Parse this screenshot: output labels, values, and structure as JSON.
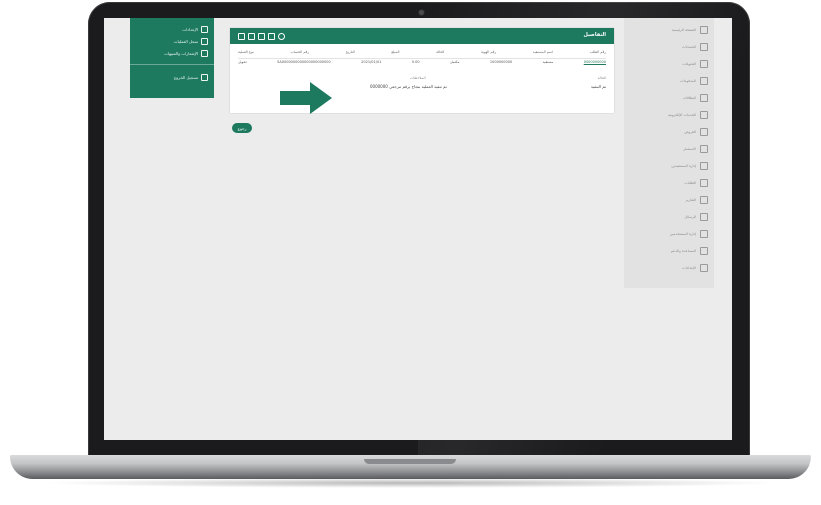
{
  "left_panel": {
    "items": [
      {
        "label": "الإعدادات",
        "icon": "settings-icon"
      },
      {
        "label": "سجل العمليات",
        "icon": "log-icon"
      },
      {
        "label": "الإشعارات والتنبيهات",
        "icon": "bell-icon"
      },
      {
        "label": "تسجيل الخروج",
        "icon": "logout-icon"
      }
    ]
  },
  "card": {
    "title": "التفاصيل",
    "header_icons": [
      "list-icon",
      "grid-icon",
      "document-icon",
      "print-icon",
      "info-icon"
    ],
    "columns": [
      "رقم الطلب",
      "اسم المستفيد",
      "رقم الهوية",
      "الحالة",
      "المبلغ",
      "التاريخ",
      "رقم الحساب",
      "نوع العملية"
    ],
    "row": [
      "0000000000",
      "مستفيد",
      "1000000000",
      "مكتمل",
      "0.00",
      "2021/01/01",
      "SA0000000000000000000000",
      "تحويل"
    ],
    "detail_label": "الحالة",
    "detail_value": "تم التنفيذ",
    "detail_label_2": "الملاحظات",
    "detail_value_2": "تم تنفيذ العملية بنجاح برقم مرجعي 0000000"
  },
  "back_button_label": "رجوع",
  "right_sidebar": {
    "items": [
      {
        "label": "الصفحة الرئيسية",
        "icon": "home-icon"
      },
      {
        "label": "الحسابات",
        "icon": "accounts-icon"
      },
      {
        "label": "التحويلات",
        "icon": "transfer-icon"
      },
      {
        "label": "المدفوعات",
        "icon": "payments-icon"
      },
      {
        "label": "البطاقات",
        "icon": "card-icon"
      },
      {
        "label": "الخدمات الإلكترونية",
        "icon": "services-icon"
      },
      {
        "label": "القروض",
        "icon": "loan-icon"
      },
      {
        "label": "الاستثمار",
        "icon": "chart-icon"
      },
      {
        "label": "إدارة المستفيدين",
        "icon": "users-icon"
      },
      {
        "label": "الطلبات",
        "icon": "request-icon"
      },
      {
        "label": "التقارير",
        "icon": "report-icon"
      },
      {
        "label": "الرسائل",
        "icon": "mail-icon"
      },
      {
        "label": "إدارة المستخدمين",
        "icon": "user-admin-icon"
      },
      {
        "label": "المساعدة والدعم",
        "icon": "help-icon"
      },
      {
        "label": "الإعدادات",
        "icon": "gear-icon"
      }
    ]
  },
  "colors": {
    "accent": "#1d7a5f",
    "sidebar_bg": "#e2e2e2",
    "screen_bg": "#ececec"
  }
}
